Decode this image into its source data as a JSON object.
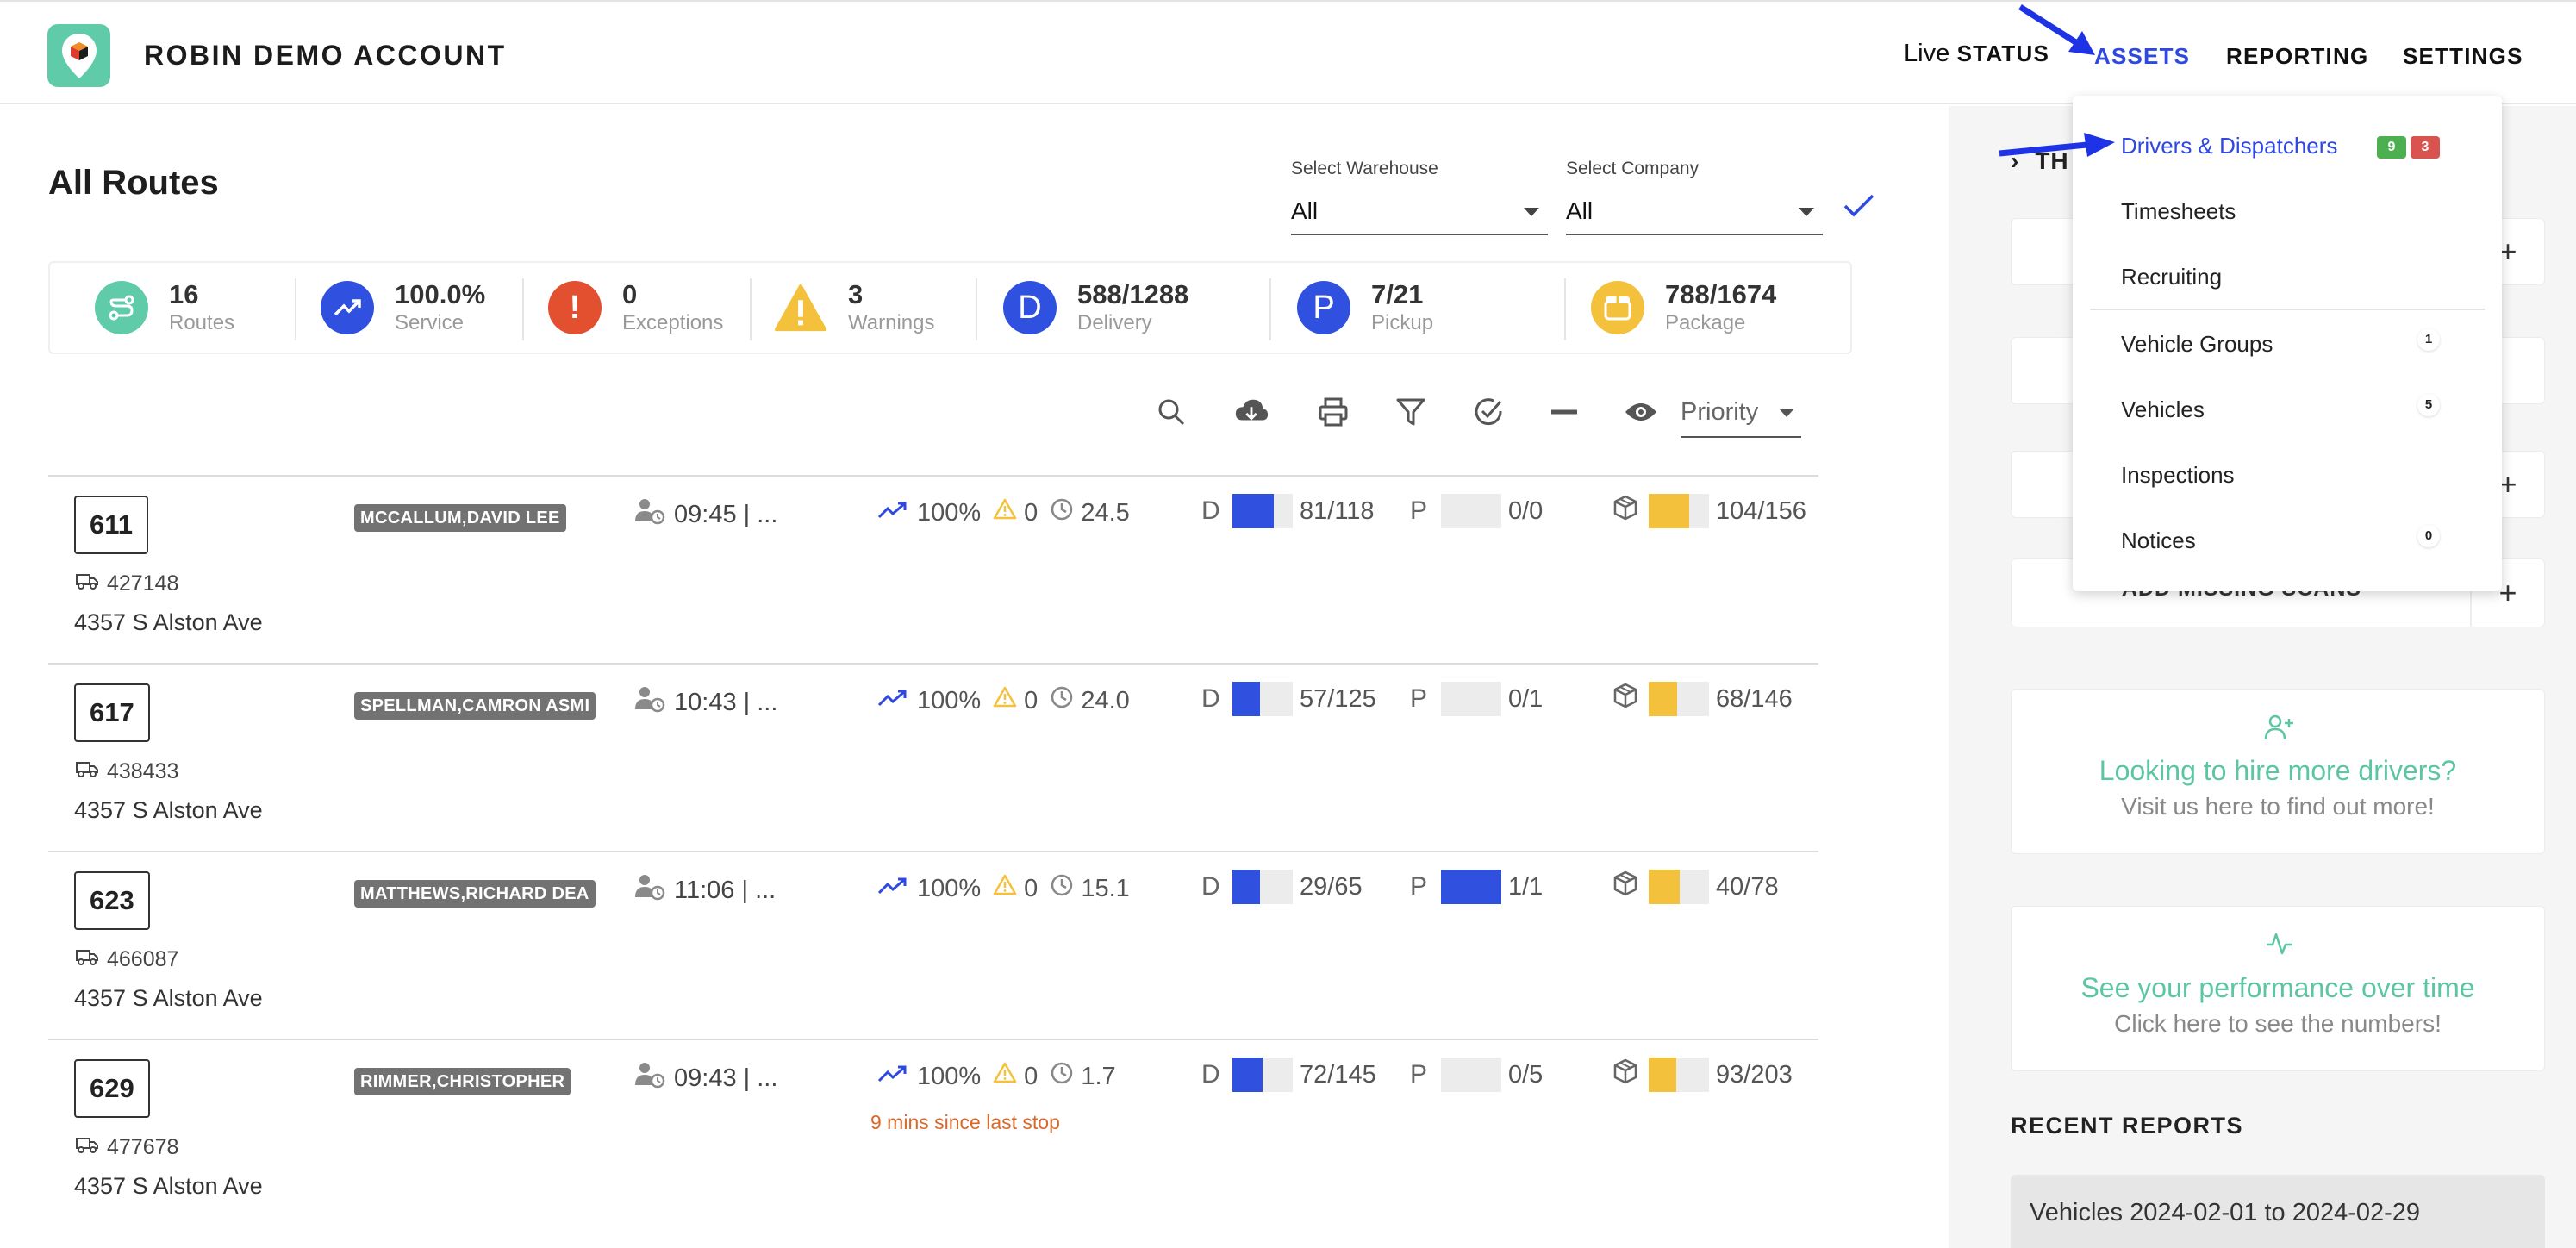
{
  "header": {
    "account_name": "ROBIN DEMO ACCOUNT",
    "nav": {
      "live_prefix": "Live",
      "status": "STATUS",
      "assets": "ASSETS",
      "reporting": "REPORTING",
      "settings": "SETTINGS"
    }
  },
  "page": {
    "title": "All Routes",
    "warehouse": {
      "label": "Select Warehouse",
      "value": "All"
    },
    "company": {
      "label": "Select Company",
      "value": "All"
    }
  },
  "stats": [
    {
      "value": "16",
      "label": "Routes",
      "icon": "route-icon",
      "color": "#5fcba8"
    },
    {
      "value": "100.0%",
      "label": "Service",
      "icon": "trending-up-icon",
      "color": "#3050e0"
    },
    {
      "value": "0",
      "label": "Exceptions",
      "icon": "exclamation-icon",
      "color": "#e2502f"
    },
    {
      "value": "3",
      "label": "Warnings",
      "icon": "warning-icon",
      "color": "#f4c13c"
    },
    {
      "value": "588/1288",
      "label": "Delivery",
      "icon": "D",
      "color": "#3050e0"
    },
    {
      "value": "7/21",
      "label": "Pickup",
      "icon": "P",
      "color": "#3050e0"
    },
    {
      "value": "788/1674",
      "label": "Package",
      "icon": "package-icon",
      "color": "#f4c13c"
    }
  ],
  "toolbar": {
    "sort_value": "Priority",
    "icons": [
      "search-icon",
      "cloud-download-icon",
      "printer-icon",
      "filter-icon",
      "check-circle-icon",
      "minus-icon",
      "eye-icon"
    ]
  },
  "routes": [
    {
      "number": "611",
      "vehicle": "427148",
      "address": "4357 S Alston Ave",
      "driver": "MCCALLUM,DAVID LEE",
      "start": "09:45 | ...",
      "service": "100%",
      "warnings": "0",
      "time": "24.5",
      "since": "",
      "delivery_label": "D",
      "delivery": "81/118",
      "delivery_fill": 0.69,
      "pickup_label": "P",
      "pickup": "0/0",
      "pickup_fill": 0,
      "package": "104/156",
      "package_fill": 0.67
    },
    {
      "number": "617",
      "vehicle": "438433",
      "address": "4357 S Alston Ave",
      "driver": "SPELLMAN,CAMRON ASMI",
      "start": "10:43 | ...",
      "service": "100%",
      "warnings": "0",
      "time": "24.0",
      "since": "",
      "delivery_label": "D",
      "delivery": "57/125",
      "delivery_fill": 0.46,
      "pickup_label": "P",
      "pickup": "0/1",
      "pickup_fill": 0,
      "package": "68/146",
      "package_fill": 0.47
    },
    {
      "number": "623",
      "vehicle": "466087",
      "address": "4357 S Alston Ave",
      "driver": "MATTHEWS,RICHARD DEA",
      "start": "11:06 | ...",
      "service": "100%",
      "warnings": "0",
      "time": "15.1",
      "since": "",
      "delivery_label": "D",
      "delivery": "29/65",
      "delivery_fill": 0.45,
      "pickup_label": "P",
      "pickup": "1/1",
      "pickup_fill": 1,
      "package": "40/78",
      "package_fill": 0.51
    },
    {
      "number": "629",
      "vehicle": "477678",
      "address": "4357 S Alston Ave",
      "driver": "RIMMER,CHRISTOPHER",
      "start": "09:43 | ...",
      "service": "100%",
      "warnings": "0",
      "time": "1.7",
      "since": "9 mins since last stop",
      "delivery_label": "D",
      "delivery": "72/145",
      "delivery_fill": 0.5,
      "pickup_label": "P",
      "pickup": "0/5",
      "pickup_fill": 0,
      "package": "93/203",
      "package_fill": 0.46
    }
  ],
  "dropdown": {
    "items": [
      {
        "label": "Drivers & Dispatchers",
        "badges": [
          "9",
          "3"
        ]
      },
      {
        "label": "Timesheets"
      },
      {
        "label": "Recruiting"
      },
      {
        "label": "Vehicle Groups",
        "count": "1"
      },
      {
        "label": "Vehicles",
        "count": "5"
      },
      {
        "label": "Inspections"
      },
      {
        "label": "Notices",
        "count": "0"
      }
    ]
  },
  "right_panel": {
    "partial_heading": "TH",
    "add_missing_scans": "ADD MISSING SCANS",
    "hire": {
      "title": "Looking to hire more drivers?",
      "subtitle": "Visit us here to find out more!"
    },
    "performance": {
      "title": "See your performance over time",
      "subtitle": "Click here to see the numbers!"
    },
    "recent_reports_title": "RECENT REPORTS",
    "recent_report": "Vehicles 2024-02-01 to 2024-02-29"
  },
  "colors": {
    "accent_blue": "#3050e0",
    "brand_green": "#5fcba8",
    "package_yellow": "#f4c13c",
    "badge_green": "#4caf50",
    "badge_red": "#d9534f",
    "alert_orange": "#d9682b"
  }
}
